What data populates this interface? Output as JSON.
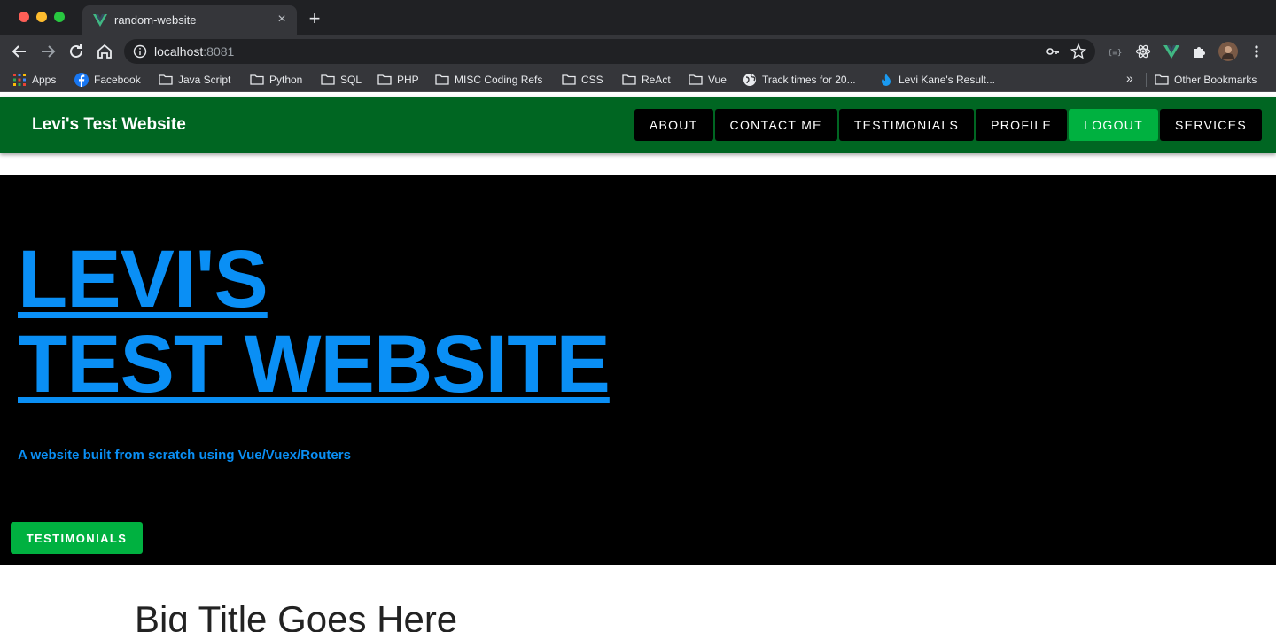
{
  "browser": {
    "tab_title": "random-website",
    "tab_close": "×",
    "new_tab": "+",
    "url_host": "localhost",
    "url_port": ":8081",
    "bookmarks": [
      {
        "label": "Apps",
        "icon": "apps-grid-icon"
      },
      {
        "label": "Facebook",
        "icon": "facebook-icon"
      },
      {
        "label": "Java Script",
        "icon": "folder-icon"
      },
      {
        "label": "Python",
        "icon": "folder-icon"
      },
      {
        "label": "SQL",
        "icon": "folder-icon"
      },
      {
        "label": "PHP",
        "icon": "folder-icon"
      },
      {
        "label": "MISC Coding Refs",
        "icon": "folder-icon"
      },
      {
        "label": "CSS",
        "icon": "folder-icon"
      },
      {
        "label": "ReAct",
        "icon": "folder-icon"
      },
      {
        "label": "Vue",
        "icon": "folder-icon"
      },
      {
        "label": "Track times for 20...",
        "icon": "globe-icon"
      },
      {
        "label": "Levi Kane's Result...",
        "icon": "flame-icon"
      }
    ],
    "more": "»",
    "other_bookmarks": "Other Bookmarks"
  },
  "site": {
    "title": "Levi's Test Website",
    "nav": [
      "ABOUT",
      "CONTACT ME",
      "TESTIMONIALS",
      "PROFILE",
      "LOGOUT",
      "SERVICES"
    ],
    "active_nav": "LOGOUT",
    "hero_line1": "LEVI'S",
    "hero_line2": "TEST WEBSITE",
    "hero_subtitle": "A website built from scratch using Vue/Vuex/Routers",
    "hero_button": "TESTIMONIALS",
    "section_title": "Big Title Goes Here"
  },
  "colors": {
    "appbar": "#006622",
    "accent_green": "#00b140",
    "hero_blue": "#0a8ff5",
    "hero_bg": "#000000"
  }
}
